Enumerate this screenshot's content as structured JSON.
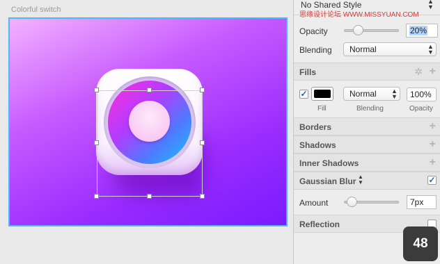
{
  "canvas": {
    "artboard_title": "Colorful switch"
  },
  "inspector": {
    "shared_style": "No Shared Style",
    "opacity": {
      "label": "Opacity",
      "value": "20%",
      "level": 0.2
    },
    "blending": {
      "label": "Blending",
      "value": "Normal"
    },
    "fills": {
      "title": "Fills",
      "enabled": true,
      "color": "#000000",
      "blend_value": "Normal",
      "opacity_value": "100%",
      "fill_label": "Fill",
      "blending_label": "Blending",
      "opacity_label": "Opacity"
    },
    "borders": {
      "title": "Borders"
    },
    "shadows": {
      "title": "Shadows"
    },
    "inner_shadows": {
      "title": "Inner Shadows"
    },
    "gaussian_blur": {
      "title": "Gaussian Blur",
      "enabled": true
    },
    "amount": {
      "label": "Amount",
      "value": "7px",
      "level": 0.07
    },
    "reflection": {
      "title": "Reflection",
      "enabled": false
    }
  },
  "watermark": "思缘设计论坛 WWW.MISSYUAN.COM",
  "badge": "48",
  "colors": {
    "selection": "#4fb6ff",
    "checkbox_accent": "#1e5ed8"
  }
}
